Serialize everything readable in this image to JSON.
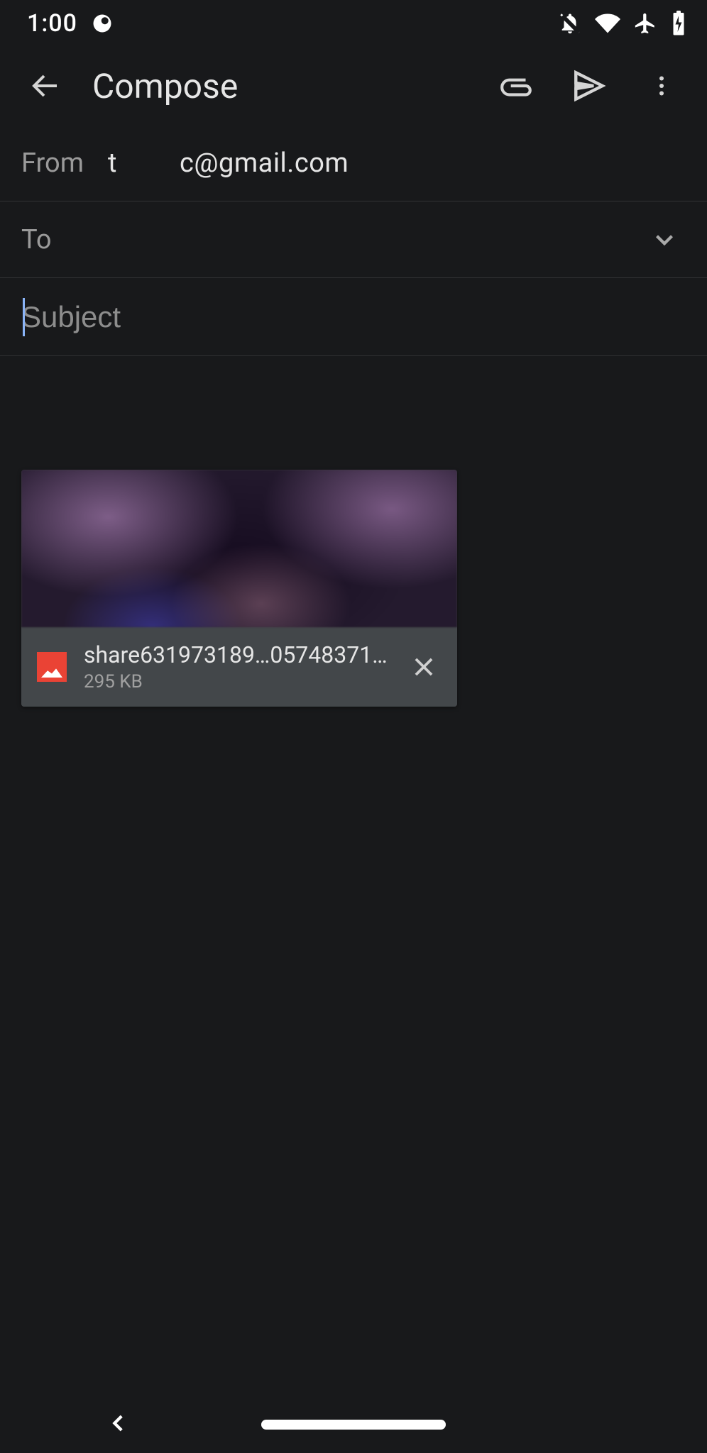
{
  "status": {
    "time": "1:00"
  },
  "appbar": {
    "title": "Compose"
  },
  "from": {
    "label": "From",
    "name": "t",
    "email": "c@gmail.com"
  },
  "to": {
    "label": "To",
    "value": ""
  },
  "subject": {
    "placeholder": "Subject",
    "value": ""
  },
  "attachment": {
    "filename": "share631973189…05748371.png",
    "size": "295 KB"
  }
}
